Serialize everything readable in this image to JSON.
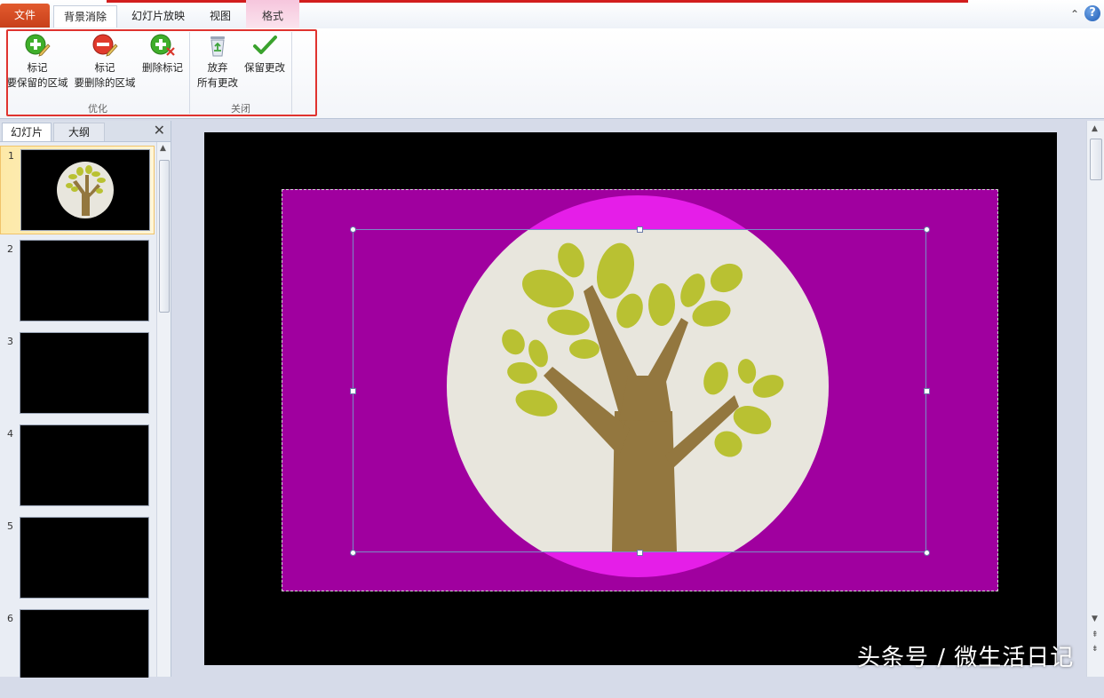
{
  "tabs": {
    "file": "文件",
    "background_removal": "背景消除",
    "slideshow": "幻灯片放映",
    "view": "视图",
    "format": "格式"
  },
  "ribbon": {
    "groups": [
      {
        "label": "优化"
      },
      {
        "label": "关闭"
      }
    ],
    "buttons": {
      "mark_keep": {
        "line1": "标记",
        "line2": "要保留的区域",
        "icon": "plus-pencil-icon"
      },
      "mark_remove": {
        "line1": "标记",
        "line2": "要删除的区域",
        "icon": "minus-pencil-icon"
      },
      "delete_mark": {
        "line1": "删除标记",
        "icon": "plus-eraser-icon"
      },
      "discard": {
        "line1": "放弃",
        "line2": "所有更改",
        "icon": "recycle-bin-icon"
      },
      "keep": {
        "line1": "保留更改",
        "icon": "checkmark-icon"
      }
    }
  },
  "pane": {
    "tab_slides": "幻灯片",
    "tab_outline": "大纲",
    "slides": [
      {
        "num": "1",
        "selected": true,
        "has_tree": true
      },
      {
        "num": "2"
      },
      {
        "num": "3"
      },
      {
        "num": "4"
      },
      {
        "num": "5"
      },
      {
        "num": "6"
      }
    ]
  },
  "watermark": "头条号 / 微生活日记",
  "colors": {
    "removal_overlay": "#a0009f",
    "circle": "#e8e6dd",
    "trunk": "#93773f",
    "leaf": "#b9c132",
    "highlight_box": "#e0332f"
  }
}
